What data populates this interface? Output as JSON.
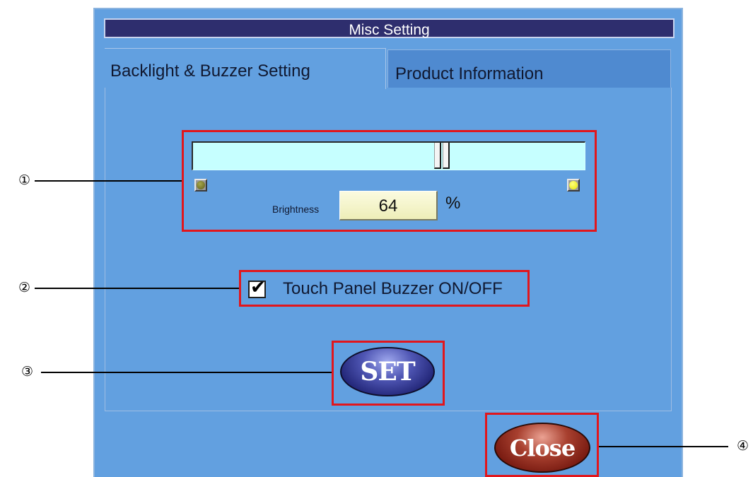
{
  "window": {
    "title": "Misc Setting"
  },
  "tabs": [
    {
      "label": "Backlight & Buzzer Setting",
      "active": true
    },
    {
      "label": "Product Information",
      "active": false
    }
  ],
  "backlight": {
    "slider_level_percent": 64,
    "dim_indicator": "dim-lamp-icon",
    "bright_indicator": "bright-lamp-icon",
    "brightness_label": "Brightness",
    "brightness_value": "64",
    "unit": "%"
  },
  "buzzer": {
    "checked": true,
    "label": "Touch Panel Buzzer ON/OFF"
  },
  "buttons": {
    "set_label": "SET",
    "close_label": "Close"
  },
  "callouts": [
    "①",
    "②",
    "③",
    "④"
  ],
  "colors": {
    "window_background": "#62a0e0",
    "titlebar_background": "#2e2e6e",
    "highlight_border": "#e2161c",
    "slider_track": "#c6ffff",
    "set_button": "#24287a",
    "close_button": "#7a1c12"
  }
}
